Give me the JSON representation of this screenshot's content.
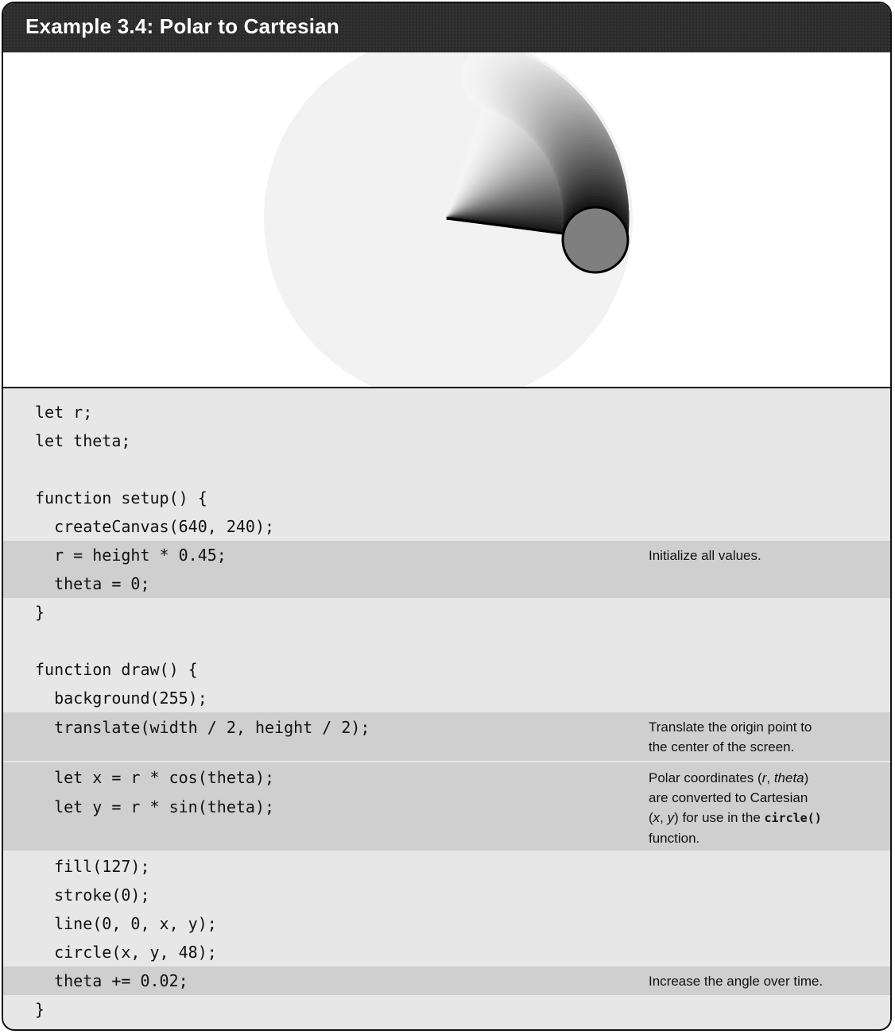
{
  "header": {
    "title": "Example 3.4: Polar to Cartesian"
  },
  "code": {
    "lines": [
      "let r;",
      "let theta;",
      "",
      "function setup() {",
      "  createCanvas(640, 240);",
      "  r = height * 0.45;",
      "  theta = 0;",
      "}",
      "",
      "function draw() {",
      "  background(255);",
      "  translate(width / 2, height / 2);",
      "  let x = r * cos(theta);",
      "  let y = r * sin(theta);",
      "  fill(127);",
      "  stroke(0);",
      "  line(0, 0, x, y);",
      "  circle(x, y, 48);",
      "  theta += 0.02;",
      "}"
    ]
  },
  "notes": {
    "init": "Initialize all values.",
    "translate_1": "Translate the origin point to",
    "translate_2": "the center of the screen.",
    "polar_1_a": "Polar coordinates (",
    "polar_1_r": "r",
    "polar_1_sep": ", ",
    "polar_1_theta": "theta",
    "polar_1_b": ")",
    "polar_2": "are converted to Cartesian",
    "polar_3_a": "(",
    "polar_3_x": "x",
    "polar_3_sep": ", ",
    "polar_3_y": "y",
    "polar_3_b": ") for use in the ",
    "polar_3_code": "circle()",
    "polar_4": "function.",
    "increase": "Increase the angle over time."
  }
}
